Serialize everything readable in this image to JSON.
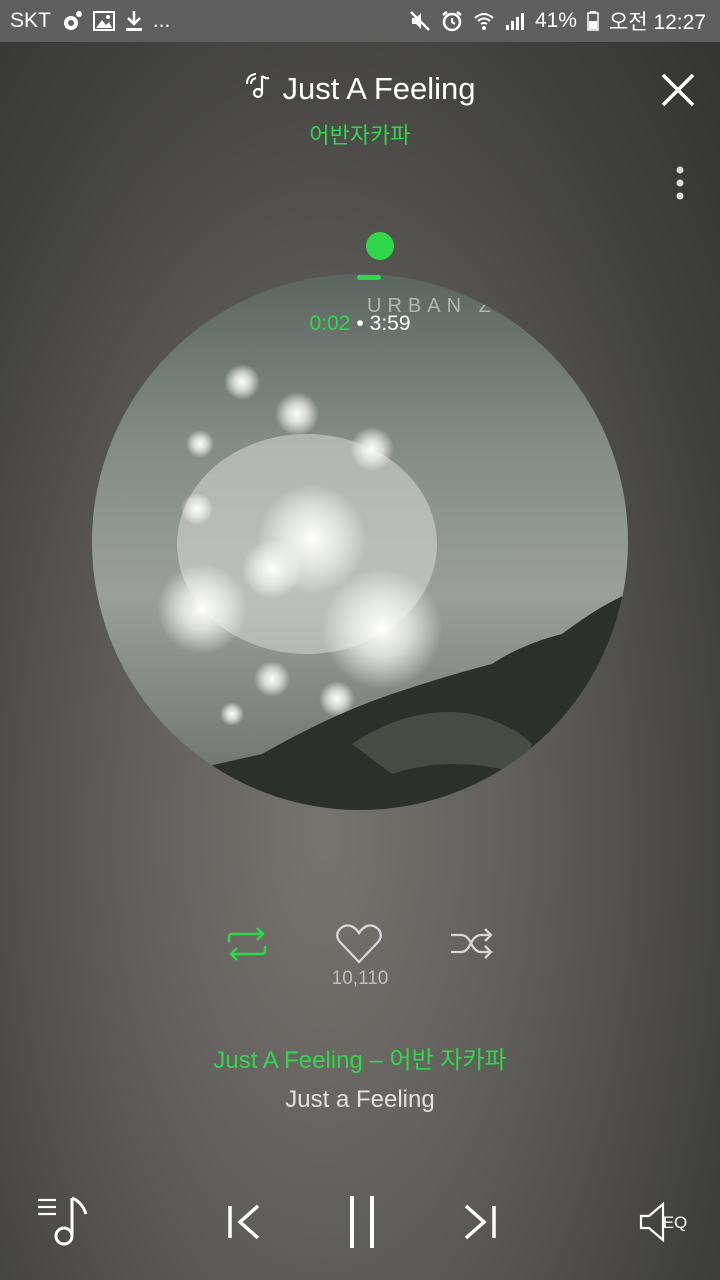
{
  "status_bar": {
    "carrier": "SKT",
    "more": "...",
    "battery": "41%",
    "time": "오전 12:27"
  },
  "header": {
    "title": "Just A Feeling",
    "artist": "어반자카파"
  },
  "album_art": {
    "overlay_text": "URBAN Z"
  },
  "player": {
    "current_time": "0:02",
    "separator": "•",
    "total_time": "3:59",
    "progress_fraction": 0.008
  },
  "actions": {
    "like_count": "10,110"
  },
  "track_info": {
    "song_line": "Just A Feeling – 어반 자카파",
    "album_line": "Just a Feeling"
  },
  "bottom_controls": {
    "eq_label": "EQ"
  },
  "colors": {
    "accent": "#2fd84a",
    "status_bar_bg": "#5f5f5f"
  }
}
